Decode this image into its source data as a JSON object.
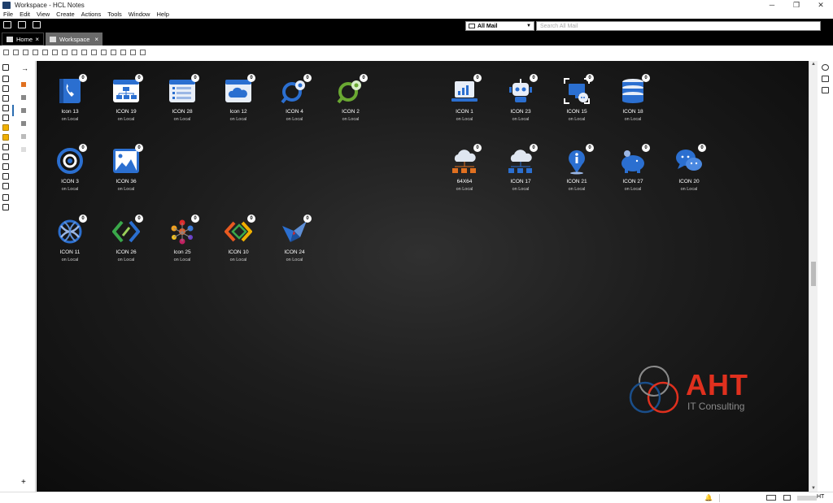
{
  "window": {
    "title": "Workspace - HCL Notes",
    "minimize": "─",
    "maximize": "❐",
    "close": "✕"
  },
  "menu": [
    "File",
    "Edit",
    "View",
    "Create",
    "Actions",
    "Tools",
    "Window",
    "Help"
  ],
  "tabs": [
    {
      "label": "Home",
      "close": "×"
    },
    {
      "label": "Workspace",
      "close": "×"
    }
  ],
  "search": {
    "scope": "All Mail",
    "placeholder": "Search All Mail",
    "clear": "✕",
    "filter": "⚙",
    "go": "⌕"
  },
  "colors": {
    "desktop_bg": "#1d1d1d",
    "tab_active": "#6a6a6a",
    "badge": "#ffffff",
    "aht_red": "#e0301e",
    "icon_blue": "#2b6fd0"
  },
  "tiles": [
    {
      "name": "Icon 13",
      "sub": "on Local",
      "badge": "0",
      "icon": "phone-book-icon"
    },
    {
      "name": "ICON 19",
      "sub": "on Local",
      "badge": "0",
      "icon": "org-chart-icon"
    },
    {
      "name": "ICON 28",
      "sub": "on Local",
      "badge": "0",
      "icon": "form-list-icon"
    },
    {
      "name": "Icon 12",
      "sub": "on Local",
      "badge": "0",
      "icon": "cloud-window-icon"
    },
    {
      "name": "ICON 4",
      "sub": "on Local",
      "badge": "0",
      "icon": "search-gear-icon"
    },
    {
      "name": "ICON 2",
      "sub": "on Local",
      "badge": "0",
      "icon": "search-gear-green-icon"
    },
    {
      "name": "ICON 1",
      "sub": "on Local",
      "badge": "0",
      "icon": "laptop-chart-icon"
    },
    {
      "name": "ICON 23",
      "sub": "on Local",
      "badge": "0",
      "icon": "robot-icon"
    },
    {
      "name": "ICON 15",
      "sub": "on Local",
      "badge": "0",
      "icon": "monitor-chat-icon"
    },
    {
      "name": "ICON 18",
      "sub": "on Local",
      "badge": "0",
      "icon": "database-icon"
    },
    {
      "name": "ICON 3",
      "sub": "on Local",
      "badge": "0",
      "icon": "target-ring-icon"
    },
    {
      "name": "ICON 36",
      "sub": "on Local",
      "badge": "0",
      "icon": "landscape-window-icon"
    },
    {
      "name": "64X64",
      "sub": "on Local",
      "badge": "0",
      "icon": "cloud-network-orange-icon"
    },
    {
      "name": "ICON 17",
      "sub": "on Local",
      "badge": "0",
      "icon": "cloud-network-blue-icon"
    },
    {
      "name": "ICON 21",
      "sub": "on Local",
      "badge": "0",
      "icon": "info-pin-icon"
    },
    {
      "name": "ICON 27",
      "sub": "on Local",
      "badge": "0",
      "icon": "piggy-bank-icon"
    },
    {
      "name": "ICON 20",
      "sub": "on Local",
      "badge": "0",
      "icon": "chat-bubbles-icon"
    },
    {
      "name": "ICON 11",
      "sub": "on Local",
      "badge": "0",
      "icon": "dna-knot-icon"
    },
    {
      "name": "ICON 26",
      "sub": "on Local",
      "badge": "0",
      "icon": "code-chevrons-icon"
    },
    {
      "name": "Icon 25",
      "sub": "on Local",
      "badge": "0",
      "icon": "network-dots-icon"
    },
    {
      "name": "ICON 10",
      "sub": "on Local",
      "badge": "0",
      "icon": "colorful-code-icon"
    },
    {
      "name": "ICON 24",
      "sub": "on Local",
      "badge": "0",
      "icon": "origami-bird-icon"
    }
  ],
  "logo": {
    "title": "AHT",
    "subtitle": "IT Consulting"
  },
  "colbar": {
    "arrow": "→",
    "plus": "+"
  },
  "status": {
    "bell": "🔔",
    "locale": "HT"
  }
}
